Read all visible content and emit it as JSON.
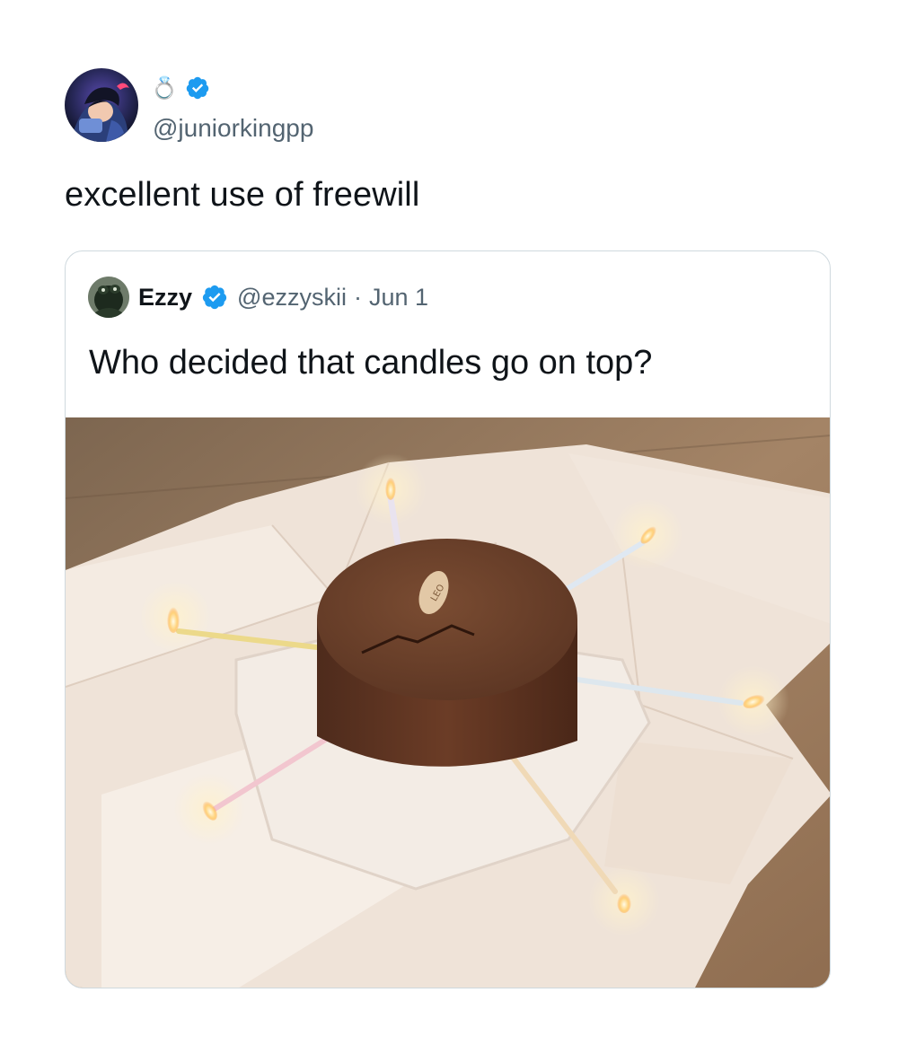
{
  "author": {
    "display_name": "💍",
    "handle": "@juniorkingpp",
    "verified": true,
    "avatar_icon": "anime-avatar-icon"
  },
  "tweet": {
    "text": "excellent use of freewill"
  },
  "quoted_tweet": {
    "display_name": "Ezzy",
    "handle": "@ezzyskii",
    "separator": "·",
    "date": "Jun 1",
    "verified": true,
    "text": "Who decided that candles go on top?",
    "media": {
      "description_icon": "photo-cake-with-sideways-candles",
      "plaque_text": "LEO"
    }
  },
  "colors": {
    "verified_blue": "#1d9bf0",
    "text_primary": "#0f1419",
    "text_secondary": "#536471",
    "border": "#cfd9de"
  }
}
